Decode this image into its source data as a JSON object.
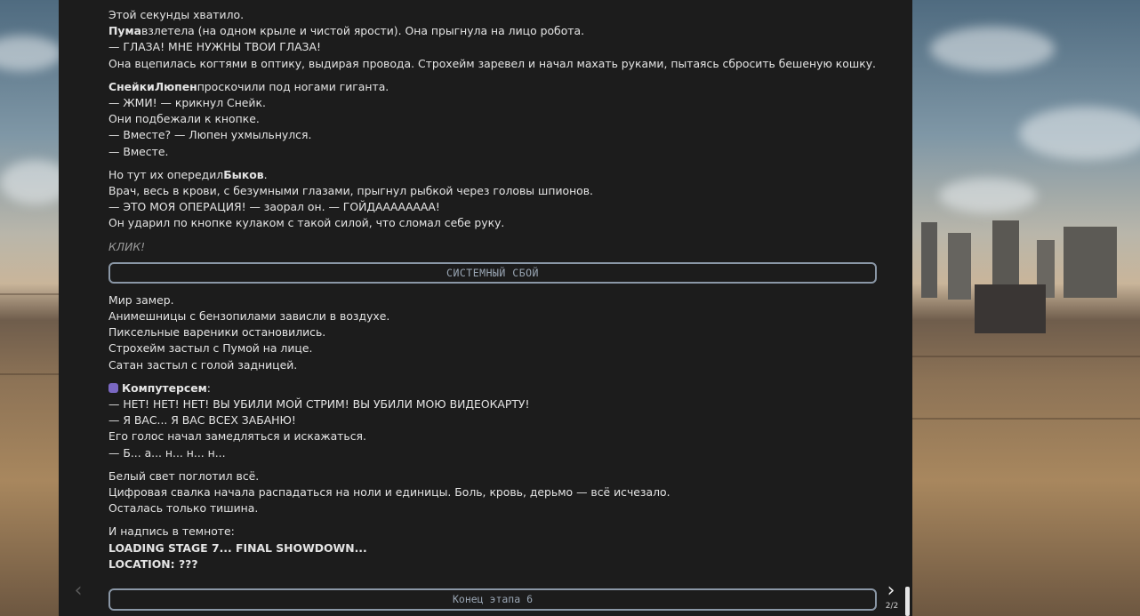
{
  "story": {
    "p1": [
      "Этой секунды хватило.",
      {
        "bold": "Пума",
        "rest": "взлетела (на одном крыле и чистой ярости). Она прыгнула на лицо робота."
      },
      "— ГЛАЗА! МНЕ НУЖНЫ ТВОИ ГЛАЗА!",
      "Она вцепилась когтями в оптику, выдирая провода. Строхейм заревел и начал махать руками, пытаясь сбросить бешеную кошку."
    ],
    "p2_bold": "СнейкиЛюпен",
    "p2_first_rest": "проскочили под ногами гиганта.",
    "p2": [
      "— ЖМИ! — крикнул Снейк.",
      "Они подбежали к кнопке.",
      "— Вместе? — Люпен ухмыльнулся.",
      "— Вместе."
    ],
    "p3_pre": "Но тут их опередил",
    "p3_bold": "Быков",
    "p3_post": ".",
    "p3": [
      "Врач, весь в крови, с безумными глазами, прыгнул рыбкой через головы шпионов.",
      "— ЭТО МОЯ ОПЕРАЦИЯ! — заорал он. — ГОЙДАААААААА!",
      "Он ударил по кнопке кулаком с такой силой, что сломал себе руку."
    ],
    "click": "КЛИК!",
    "system_failure": "СИСТЕМНЫЙ СБОЙ",
    "p4": [
      "Мир замер.",
      "Анимешницы с бензопилами зависли в воздухе.",
      "Пиксельные вареники остановились.",
      "Строхейм застыл с Пумой на лице.",
      "Сатан застыл с голой задницей."
    ],
    "p5_speaker": "Компутерсем",
    "p5_colon": ":",
    "p5": [
      "— НЕТ! НЕТ! НЕТ! ВЫ УБИЛИ МОЙ СТРИМ! ВЫ УБИЛИ МОЮ ВИДЕОКАРТУ!",
      "— Я ВАС... Я ВАС ВСЕХ ЗАБАНЮ!",
      "Его голос начал замедляться и искажаться.",
      "— Б... а... н... н... н..."
    ],
    "p6": [
      "Белый свет поглотил всё.",
      "Цифровая свалка начала распадаться на ноли и единицы. Боль, кровь, дерьмо — всё исчезало.",
      "Осталась только тишина."
    ],
    "p7_intro": "И надпись в темноте:",
    "p7_bold1": "LOADING STAGE 7... FINAL SHOWDOWN...",
    "p7_bold2": "LOCATION: ???"
  },
  "footer": {
    "end_label": "Конец этапа 6",
    "prev_icon": "chevron-left-icon",
    "next_icon": "chevron-right-icon",
    "page_indicator": "2/2"
  },
  "colors": {
    "panel_bg": "#1c1c1c",
    "text": "#e4e4e4",
    "bar_border": "#8a97a6"
  }
}
